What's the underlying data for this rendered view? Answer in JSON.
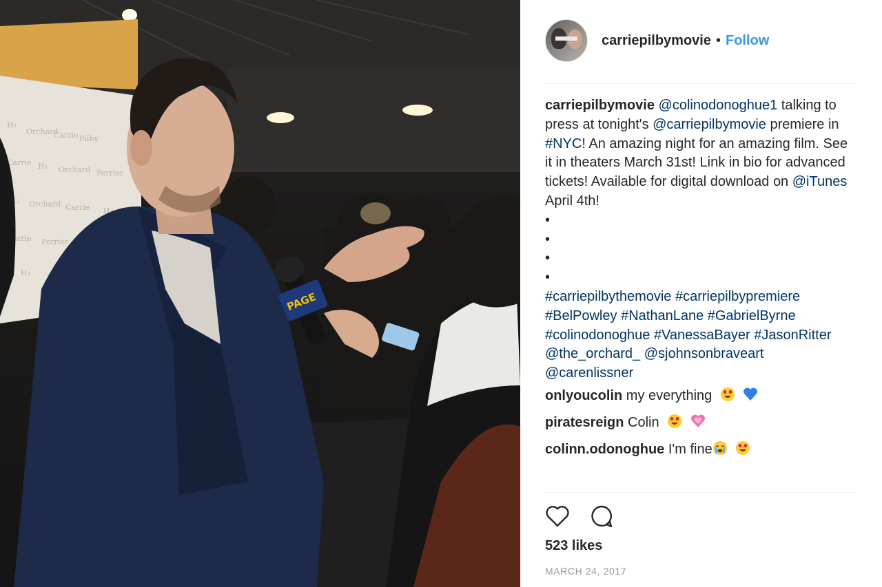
{
  "header": {
    "username": "carriepilbymovie",
    "separator": "•",
    "follow_label": "Follow"
  },
  "caption": {
    "username": "carriepilbymovie",
    "mention_1": "@colinodonoghue1",
    "text_1": " talking to press at tonight's ",
    "mention_2": "@carriepilbymovie",
    "text_2": " premiere in ",
    "hashtag_nyc": "#NYC",
    "text_3": "! An amazing night for an amazing film. See it in theaters March 31st! Link in bio for advanced tickets! Available for digital download on ",
    "mention_itunes": "@iTunes",
    "text_4": " April 4th!",
    "bullets": [
      "•",
      "•",
      "•",
      "•"
    ],
    "tags": [
      "#carriepilbythemovie",
      "#carriepilbypremiere",
      "#BelPowley",
      "#NathanLane",
      "#GabrielByrne",
      "#colinodonoghue",
      "#VanessaBayer",
      "#JasonRitter",
      "@the_orchard_",
      "@sjohnsonbraveart",
      "@carenlissner"
    ]
  },
  "comments": [
    {
      "username": "onlyoucolin",
      "text": "my everything",
      "emoji": [
        "heart-eyes-emoji",
        "blue-heart-emoji"
      ]
    },
    {
      "username": "piratesreign",
      "text": "Colin",
      "emoji": [
        "heart-eyes-emoji",
        "growing-heart-emoji"
      ]
    },
    {
      "username": "colinn.odonoghue",
      "text": "I'm fine",
      "emoji": [
        "crying-emoji",
        "heart-eyes-emoji"
      ]
    },
    {
      "username": "",
      "text": "",
      "emoji": []
    }
  ],
  "actions": {
    "like_icon": "heart-outline-icon",
    "comment_icon": "comment-bubble-icon"
  },
  "likes": "523 likes",
  "date": "MARCH 24, 2017",
  "colors": {
    "link": "#003569",
    "follow": "#3897f0",
    "text": "#262626",
    "muted": "#999999"
  }
}
